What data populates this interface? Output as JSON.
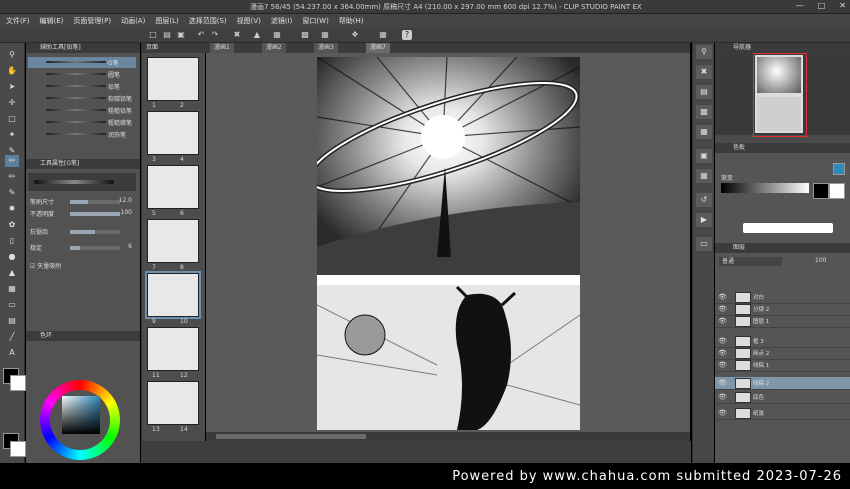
{
  "window": {
    "title": "漫画7 56/45 (54.237.00 x 364.00mm) 原稿尺寸 A4 (210.00 x 297.00 mm 600 dpi 12.7%) - CLIP STUDIO PAINT EX",
    "minimize_icon": "minimize-icon",
    "maximize_icon": "maximize-icon",
    "close_icon": "close-icon"
  },
  "menu": [
    "文件(F)",
    "编辑(E)",
    "页面管理(P)",
    "动画(A)",
    "图层(L)",
    "选择范围(S)",
    "视图(V)",
    "滤镜(I)",
    "窗口(W)",
    "帮助(H)"
  ],
  "sub_tool_panel": {
    "tab_label": "辅助工具[铅笔]",
    "brushes": [
      "G笔",
      "圆笔",
      "铅笔",
      "软碳铅笔",
      "粗糙铅笔",
      "粗糙蜡笔",
      "润饰笔"
    ],
    "tool_property_tab": "工具属性[G笔]",
    "properties": [
      {
        "label": "笔刷尺寸",
        "value": "12.0",
        "fill": 0.35
      },
      {
        "label": "不透明度",
        "value": "100",
        "fill": 1.0
      },
      {
        "label": "抗锯齿",
        "value": "",
        "fill": 0.5
      },
      {
        "label": "稳定",
        "value": "6",
        "fill": 0.2
      }
    ],
    "checkbox_label": "矢量吸附",
    "color_wheel_tab": "色环"
  },
  "pages_panel": {
    "tab_label": "页面",
    "pages": [
      {
        "left": "1",
        "right": "2"
      },
      {
        "left": "3",
        "right": "4"
      },
      {
        "left": "5",
        "right": "6"
      },
      {
        "left": "7",
        "right": "8"
      },
      {
        "left": "9",
        "right": "10"
      },
      {
        "left": "11",
        "right": "12"
      },
      {
        "left": "13",
        "right": "14"
      }
    ],
    "selected_index": 4
  },
  "canvas": {
    "tabs": [
      "漫画1",
      "漫画2",
      "漫画3",
      "漫画7"
    ],
    "active_tab": 3
  },
  "navigator": {
    "tab_label": "导航器"
  },
  "color_panel": {
    "tab_label": "色板",
    "gradient_label": "渐变",
    "main_color": "#000000",
    "sub_color": "#ffffff",
    "accent": "#2e88b8"
  },
  "layer_panel": {
    "tab_label": "图层",
    "blend_mode": "普通",
    "opacity": "100",
    "layers": [
      {
        "name": "对白",
        "visible": true,
        "selected": false
      },
      {
        "name": "分镜 2",
        "visible": true,
        "selected": false
      },
      {
        "name": "图层 1",
        "visible": true,
        "selected": false
      },
      {
        "name": "框 3",
        "visible": true,
        "selected": false
      },
      {
        "name": "网点 2",
        "visible": true,
        "selected": false
      },
      {
        "name": "线稿 1",
        "visible": true,
        "selected": false
      },
      {
        "name": "线稿 2",
        "visible": true,
        "selected": true
      },
      {
        "name": "底色",
        "visible": true,
        "selected": false
      },
      {
        "name": "纸张",
        "visible": true,
        "selected": false
      }
    ]
  },
  "watermark": "Powered by www.chahua.com submitted 2023-07-26"
}
